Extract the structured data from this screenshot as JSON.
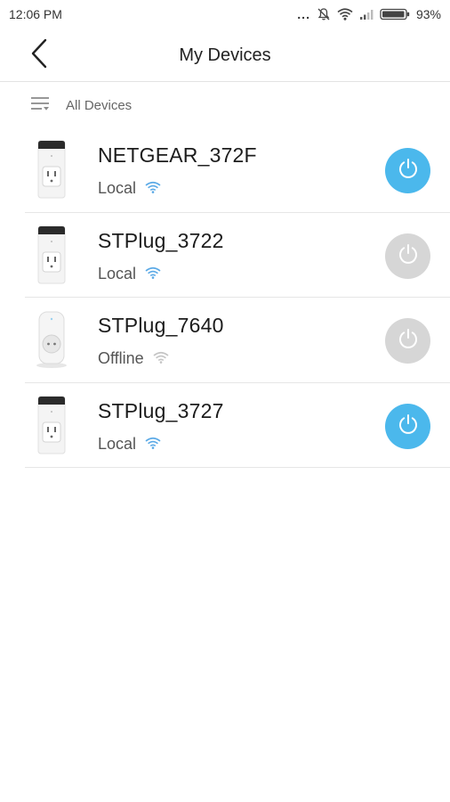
{
  "status_bar": {
    "time": "12:06 PM",
    "dots": "...",
    "battery": "93%"
  },
  "header": {
    "title": "My Devices"
  },
  "filter": {
    "label": "All Devices"
  },
  "colors": {
    "accent": "#4bb8ec",
    "off": "#d6d6d6",
    "wifi_local": "#5aa9e6",
    "wifi_offline": "#c4c4c4"
  },
  "devices": [
    {
      "name": "NETGEAR_372F",
      "status": "Local",
      "power": "on",
      "model": "us-plug"
    },
    {
      "name": "STPlug_3722",
      "status": "Local",
      "power": "off",
      "model": "us-plug"
    },
    {
      "name": "STPlug_7640",
      "status": "Offline",
      "power": "off",
      "model": "eu-plug"
    },
    {
      "name": "STPlug_3727",
      "status": "Local",
      "power": "on",
      "model": "us-plug"
    }
  ]
}
